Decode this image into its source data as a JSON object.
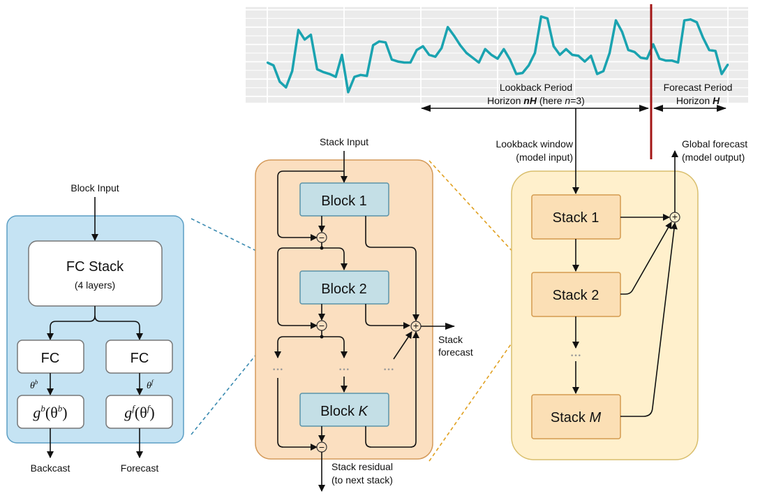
{
  "chart_data": {
    "type": "line",
    "title": "",
    "xlabel": "",
    "ylabel": "",
    "grid": true,
    "series": [
      {
        "name": "time series",
        "color": "#1aa3b0",
        "values": [
          0.42,
          0.39,
          0.22,
          0.16,
          0.33,
          0.76,
          0.66,
          0.71,
          0.35,
          0.32,
          0.3,
          0.27,
          0.5,
          0.11,
          0.27,
          0.29,
          0.28,
          0.6,
          0.64,
          0.63,
          0.45,
          0.43,
          0.42,
          0.42,
          0.55,
          0.59,
          0.5,
          0.48,
          0.57,
          0.79,
          0.7,
          0.6,
          0.52,
          0.47,
          0.42,
          0.56,
          0.5,
          0.46,
          0.56,
          0.45,
          0.3,
          0.31,
          0.39,
          0.52,
          0.9,
          0.88,
          0.59,
          0.5,
          0.56,
          0.5,
          0.49,
          0.43,
          0.49,
          0.3,
          0.33,
          0.52,
          0.86,
          0.74,
          0.55,
          0.53,
          0.47,
          0.46,
          0.61,
          0.46,
          0.44,
          0.44,
          0.42,
          0.86,
          0.87,
          0.84,
          0.68,
          0.55,
          0.54,
          0.3,
          0.4
        ]
      }
    ],
    "forecast_split_fraction": 0.87,
    "annotations": {
      "lookback_title": "Lookback Period",
      "lookback_horizon_prefix": "Horizon ",
      "lookback_horizon_var": "nH",
      "lookback_horizon_paren_prefix": " (here ",
      "lookback_horizon_n": "n",
      "lookback_horizon_eq": "=3)",
      "forecast_title": "Forecast Period",
      "forecast_horizon_prefix": "Horizon ",
      "forecast_horizon_var": "H"
    }
  },
  "block": {
    "input_label": "Block Input",
    "fc_stack_title": "FC Stack",
    "fc_stack_sub": "(4 layers)",
    "fc_left": "FC",
    "fc_right": "FC",
    "theta_b": "θ",
    "theta_b_sup": "b",
    "theta_f": "θ",
    "theta_f_sup": "f",
    "g_b": "g",
    "g_b_sup": "b",
    "g_b_arg": "(θ",
    "g_b_arg_sup": "b",
    "g_close": ")",
    "g_f": "g",
    "g_f_sup": "f",
    "g_f_arg": "(θ",
    "g_f_arg_sup": "f",
    "backcast_label": "Backcast",
    "forecast_label": "Forecast"
  },
  "stack": {
    "input_label": "Stack Input",
    "block1": "Block 1",
    "block2": "Block 2",
    "blockK_prefix": "Block ",
    "blockK_var": "K",
    "ellipsis": "•••",
    "minus": "−",
    "plus": "+",
    "forecast_label_1": "Stack",
    "forecast_label_2": "forecast",
    "residual_label_1": "Stack residual",
    "residual_label_2": "(to next stack)"
  },
  "model": {
    "input_label_1": "Lookback window",
    "input_label_2": "(model input)",
    "output_label_1": "Global forecast",
    "output_label_2": "(model output)",
    "stack1": "Stack 1",
    "stack2": "Stack 2",
    "stackM_prefix": "Stack ",
    "stackM_var": "M",
    "ellipsis": "•••",
    "plus": "+"
  },
  "colors": {
    "series": "#1aa3b0",
    "split_line": "#a31515",
    "chart_bg": "#ebebeb",
    "block_panel": "#c5e3f3",
    "block_panel_border": "#5b9ec4",
    "stack_panel": "#fbdfc0",
    "stack_panel_border": "#d49a5a",
    "block_box": "#c4dfe6",
    "block_box_border": "#5a93a8",
    "model_panel": "#fff0cc",
    "model_panel_border": "#d9be6c",
    "stack_box": "#fbdfb5",
    "stack_box_border": "#d49a4e",
    "dash_blue": "#3a8ab0",
    "dash_orange": "#e0a020"
  }
}
